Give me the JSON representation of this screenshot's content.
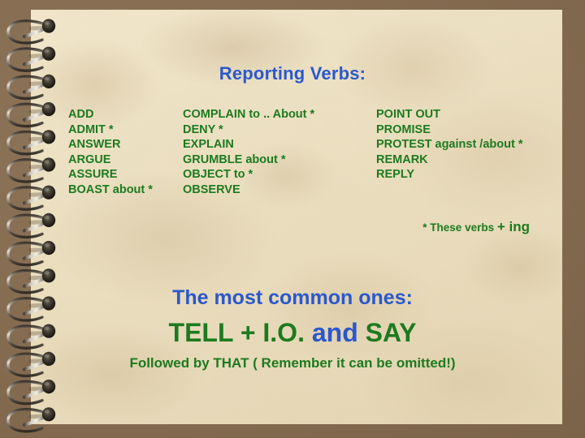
{
  "slide": {
    "background_color": "#836a4f",
    "paper_color": "#efe2c4",
    "accent_blue": "#2a58cd",
    "accent_green": "#1d7a1f"
  },
  "title": "Reporting Verbs:",
  "verb_columns": [
    {
      "name": "column-1",
      "verbs": [
        "ADD",
        "ADMIT *",
        "ANSWER",
        "ARGUE",
        "ASSURE",
        "BOAST about  *"
      ]
    },
    {
      "name": "column-2",
      "verbs": [
        "COMPLAIN to .. About *",
        "DENY *",
        "EXPLAIN",
        "GRUMBLE about *",
        "OBJECT to  *",
        "OBSERVE"
      ]
    },
    {
      "name": "column-3",
      "verbs": [
        "POINT OUT",
        "PROMISE",
        "PROTEST against /about *",
        "REMARK",
        "REPLY"
      ]
    }
  ],
  "footnote": {
    "prefix": "* These verbs ",
    "emphasis": "+ ing"
  },
  "common_heading": "The most common ones:",
  "tell_say": {
    "part_1": "TELL + I.O. ",
    "part_2_blue": "and",
    "part_3": " SAY"
  },
  "followed_by": "Followed by THAT ( Remember it can be omitted!)",
  "binding": {
    "ring_count": 15,
    "label": "spiral-wire-binding"
  }
}
